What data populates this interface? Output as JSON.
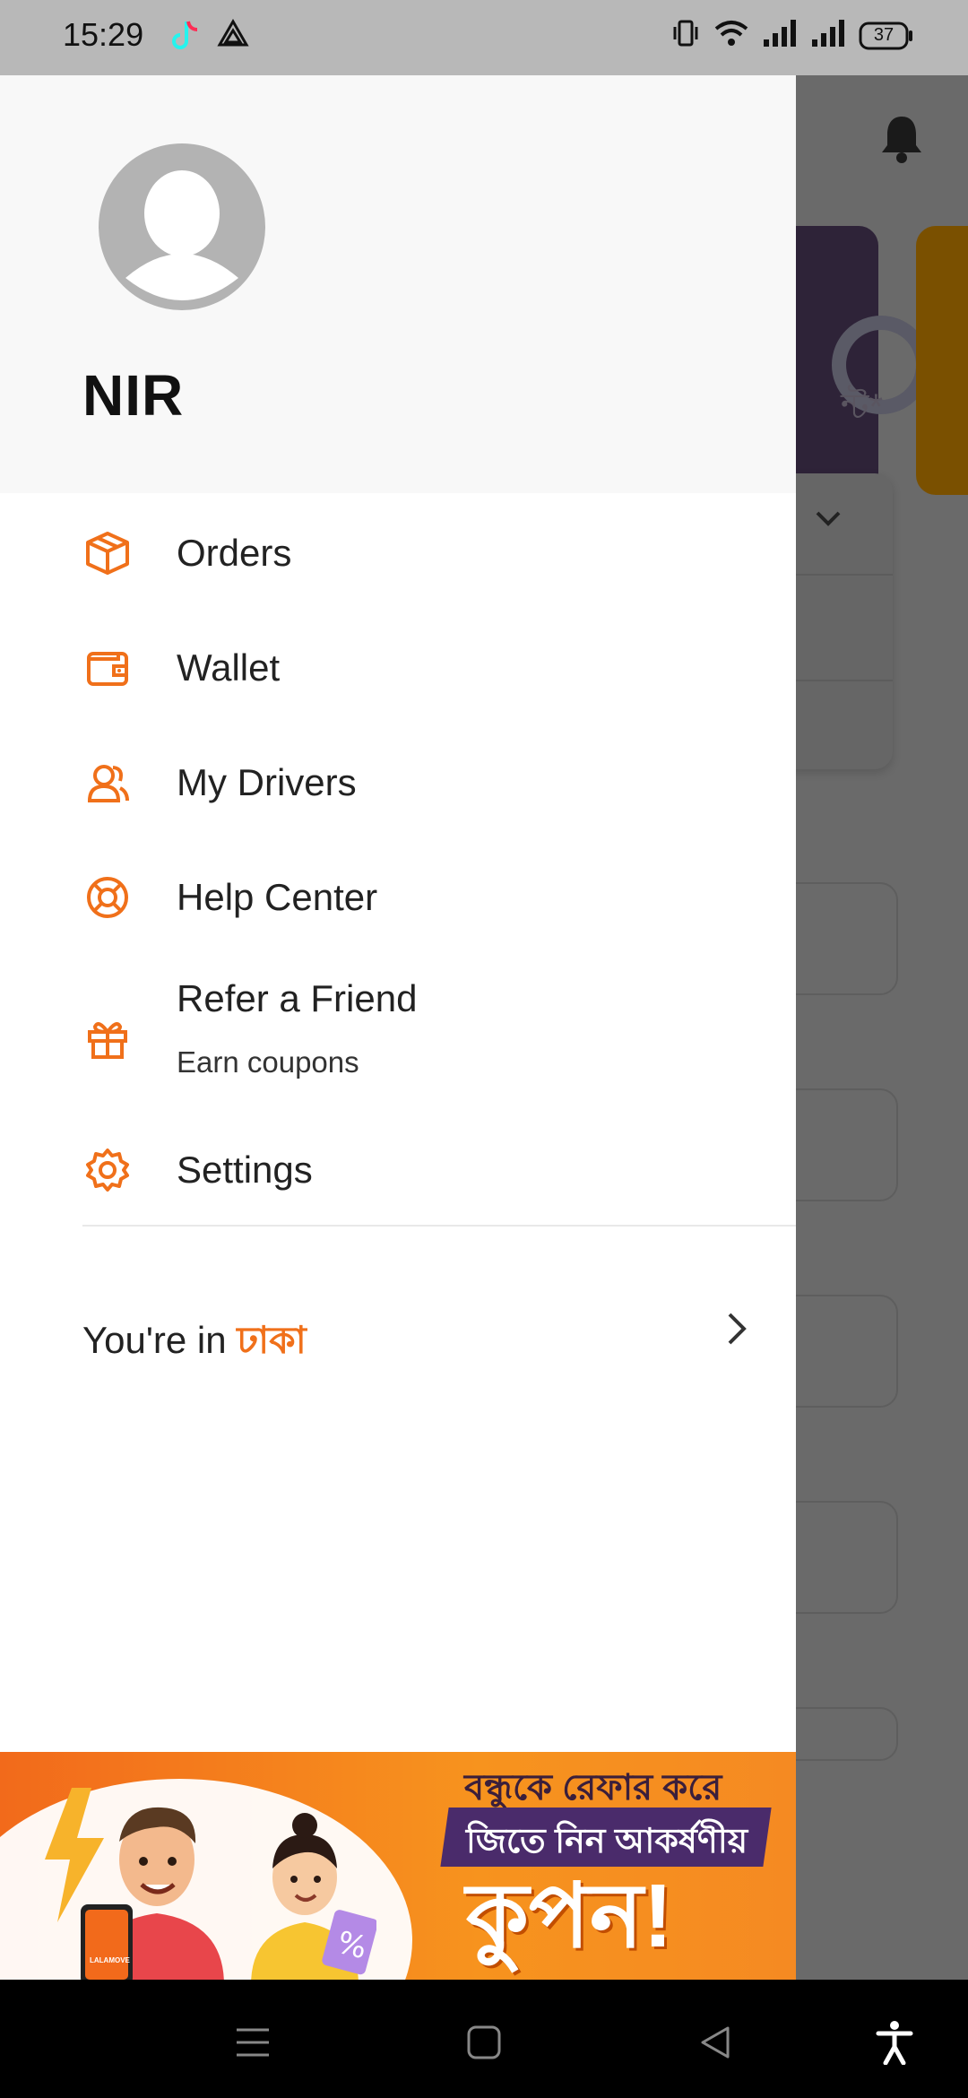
{
  "status_bar": {
    "time": "15:29",
    "battery": "37"
  },
  "drawer": {
    "user_name": "NIR",
    "menu": [
      {
        "label": "Orders",
        "icon": "package-icon"
      },
      {
        "label": "Wallet",
        "icon": "wallet-icon"
      },
      {
        "label": "My Drivers",
        "icon": "drivers-icon"
      },
      {
        "label": "Help Center",
        "icon": "lifebuoy-icon"
      },
      {
        "label": "Refer a Friend",
        "sublabel": "Earn coupons",
        "icon": "gift-icon"
      },
      {
        "label": "Settings",
        "icon": "gear-icon"
      }
    ],
    "location": {
      "prefix": "You're in ",
      "city": "ঢাকা"
    }
  },
  "banner": {
    "line1": "বন্ধুকে রেফার করে",
    "line2": "জিতে নিন আকর্ষণীয়",
    "line3": "কুপন!",
    "phone_brand": "LALAMOVE"
  },
  "background_app": {
    "card_text_fragment": "ন্ট*"
  },
  "colors": {
    "accent": "#f0701a",
    "scrim": "#6b6b6b",
    "header_bg": "#f8f8f8",
    "status_bar": "#b8b8b8"
  }
}
